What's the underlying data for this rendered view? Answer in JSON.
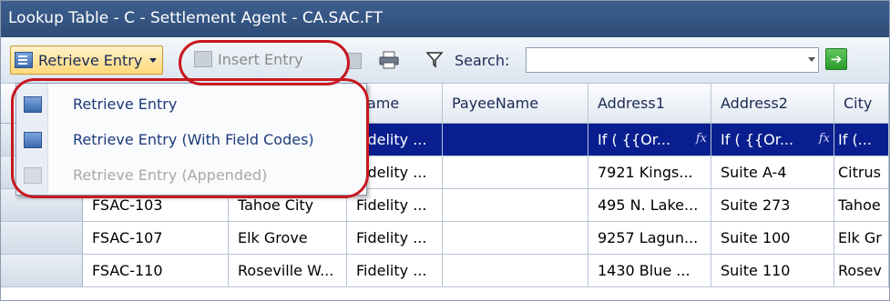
{
  "window": {
    "title": "Lookup Table - C - Settlement Agent - CA.SAC.FT"
  },
  "toolbar": {
    "retrieve_label": "Retrieve Entry",
    "insert_label": "Insert Entry",
    "search_label": "Search:",
    "search_value": "",
    "go_icon": "green-arrow-icon"
  },
  "menu": {
    "items": [
      {
        "label": "Retrieve Entry",
        "enabled": true
      },
      {
        "label": "Retrieve Entry (With Field Codes)",
        "enabled": true
      },
      {
        "label": "Retrieve Entry (Appended)",
        "enabled": false
      }
    ]
  },
  "grid": {
    "columns": [
      "",
      "",
      "",
      "Name",
      "PayeeName",
      "Address1",
      "Address2",
      "City"
    ],
    "rows": [
      [
        "",
        "",
        "",
        "Fidelity ...",
        "",
        "If ( {{Or...",
        "If ( {{Or...",
        "If (..."
      ],
      [
        "",
        "",
        "",
        "Fidelity ...",
        "",
        "7921 Kings...",
        "Suite A-4",
        "Citrus"
      ],
      [
        "",
        "FSAC-103",
        "Tahoe City",
        "Fidelity ...",
        "",
        "495 N. Lake...",
        "Suite 273",
        "Tahoe"
      ],
      [
        "",
        "FSAC-107",
        "Elk Grove",
        "Fidelity ...",
        "",
        "9257 Lagun...",
        "Suite 100",
        "Elk Gr"
      ],
      [
        "",
        "FSAC-110",
        "Roseville W...",
        "Fidelity ...",
        "",
        "1430 Blue ...",
        "Suite 110",
        "Rosev"
      ]
    ],
    "selected_row": 0,
    "formula_icon": "fx-icon"
  },
  "annotation_color": "#c8181e",
  "selection_color": "#0a1f8f"
}
